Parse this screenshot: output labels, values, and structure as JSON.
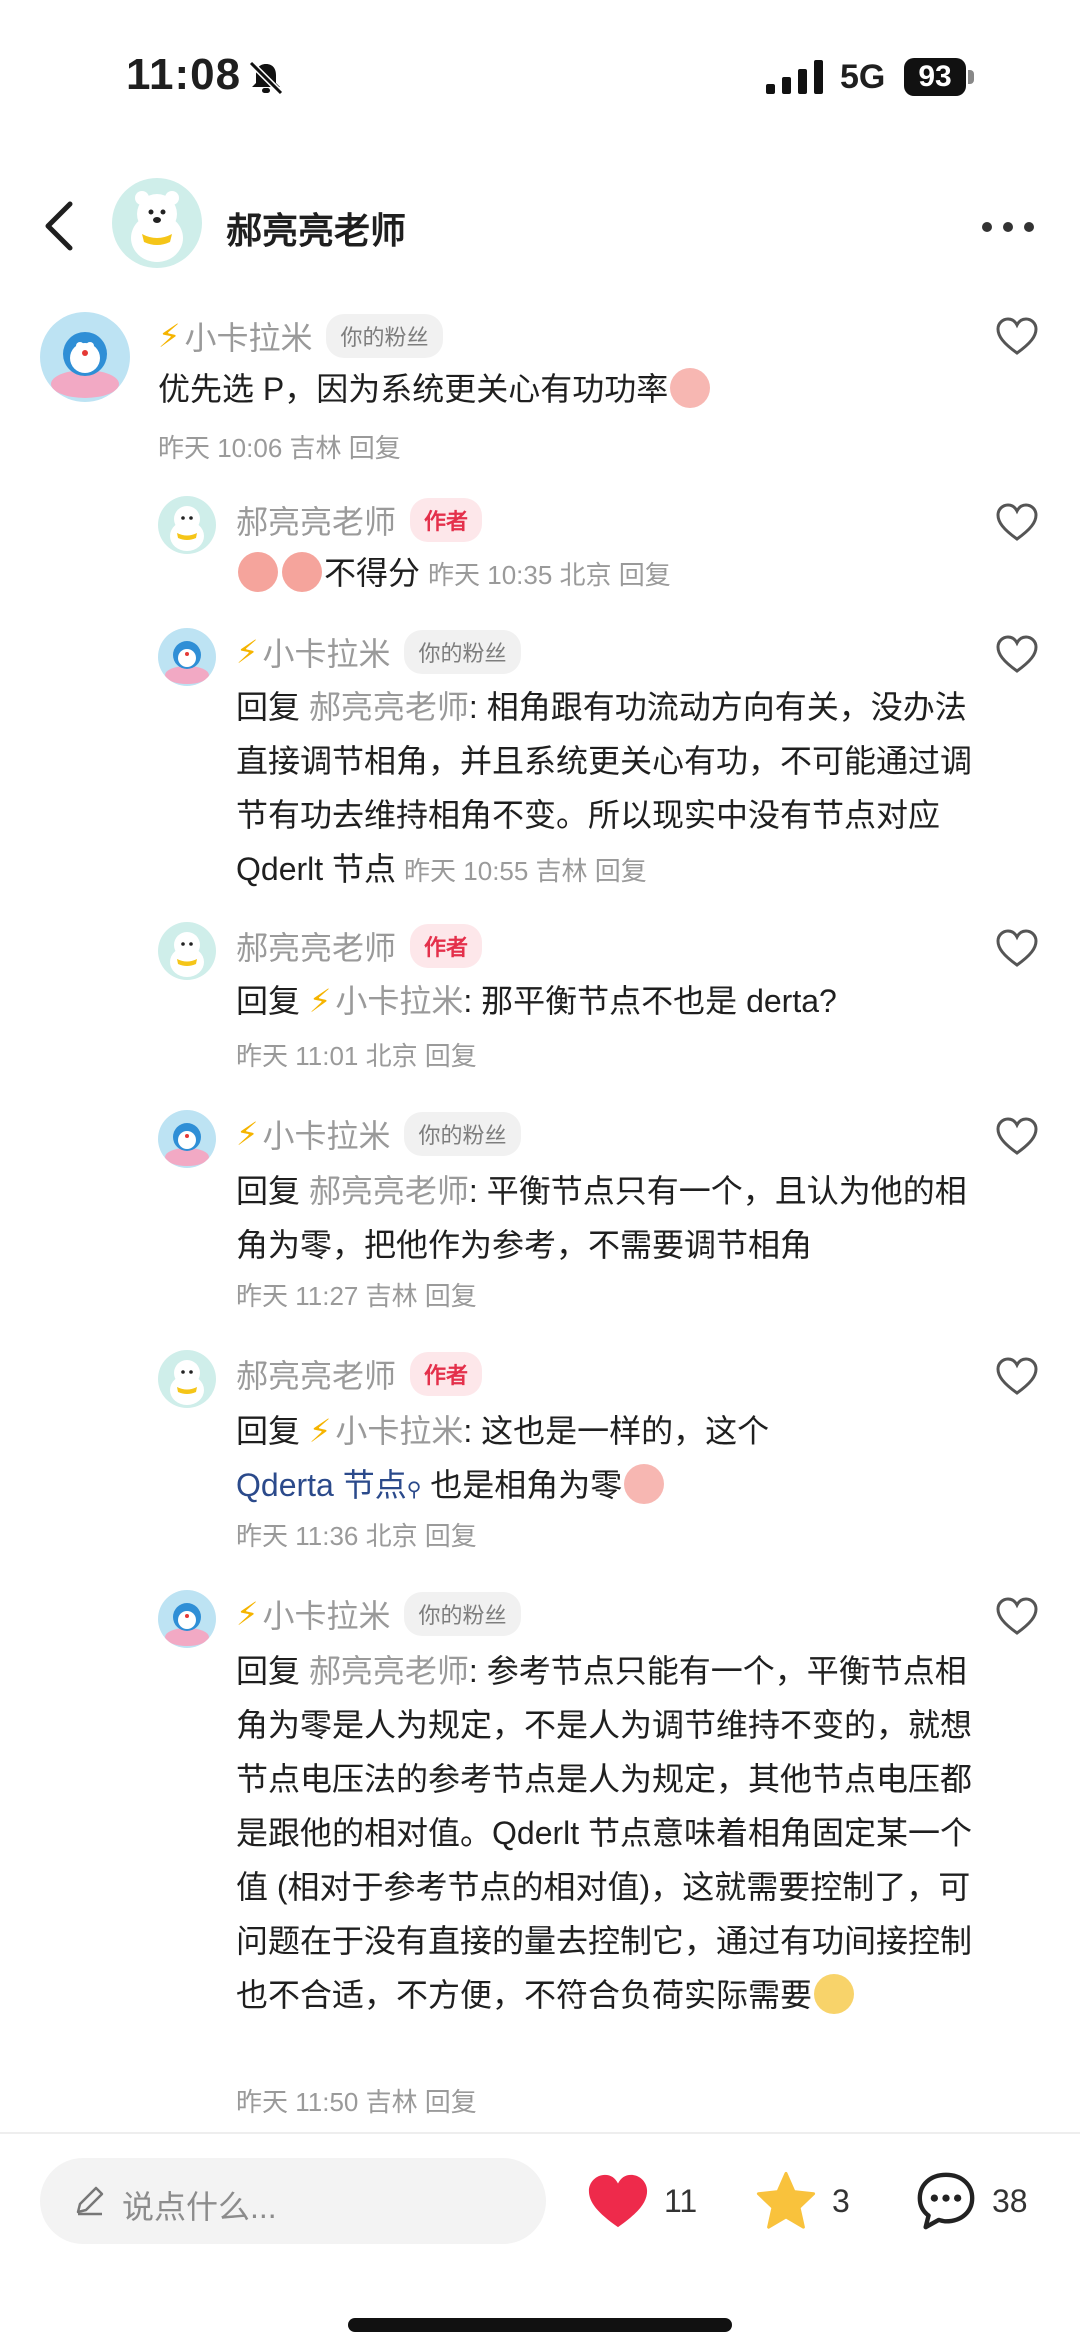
{
  "status": {
    "time": "11:08",
    "network": "5G",
    "battery": "93"
  },
  "header": {
    "title": "郝亮亮老师"
  },
  "comments": [
    {
      "user": "小卡拉米",
      "badge": "你的粉丝",
      "text": "优先选 P，因为系统更关心有功功率",
      "meta": "昨天 10:06 吉林 回复"
    },
    {
      "user": "郝亮亮老师",
      "badge": "作者",
      "text": "不得分",
      "meta": "昨天 10:35 北京 回复"
    },
    {
      "user": "小卡拉米",
      "badge": "你的粉丝",
      "reply_prefix": "回复",
      "reply_to": "郝亮亮老师",
      "text": ": 相角跟有功流动方向有关，没办法直接调节相角，并且系统更关心有功，不可能通过调节有功去维持相角不变。所以现实中没有节点对应 Qderlt 节点",
      "meta": "昨天 10:55 吉林 回复"
    },
    {
      "user": "郝亮亮老师",
      "badge": "作者",
      "reply_prefix": "回复",
      "reply_to": "小卡拉米",
      "text": ": 那平衡节点不也是 derta?",
      "meta": "昨天 11:01 北京 回复"
    },
    {
      "user": "小卡拉米",
      "badge": "你的粉丝",
      "reply_prefix": "回复",
      "reply_to": "郝亮亮老师",
      "text": ": 平衡节点只有一个，且认为他的相角为零，把他作为参考，不需要调节相角",
      "meta": "昨天 11:27 吉林 回复"
    },
    {
      "user": "郝亮亮老师",
      "badge": "作者",
      "reply_prefix": "回复",
      "reply_to": "小卡拉米",
      "text": ": 这也是一样的，这个",
      "link": "Qderta 节点",
      "text_after": " 也是相角为零",
      "meta": "昨天 11:36 北京 回复"
    },
    {
      "user": "小卡拉米",
      "badge": "你的粉丝",
      "reply_prefix": "回复",
      "reply_to": "郝亮亮老师",
      "text": ": 参考节点只能有一个，平衡节点相角为零是人为规定，不是人为调节维持不变的，就想节点电压法的参考节点是人为规定，其他节点电压都是跟他的相对值。Qderlt 节点意味着相角固定某一个值 (相对于参考节点的相对值)，这就需要控制了，可问题在于没有直接的量去控制它，通过有功间接控制也不合适，不方便，不符合负荷实际需要",
      "meta": "昨天 11:50 吉林 回复"
    }
  ],
  "bottom": {
    "placeholder": "说点什么...",
    "likes": "11",
    "stars": "3",
    "comments": "38",
    "like_color": "#ee2a4b",
    "star_color": "#f9c23c"
  }
}
